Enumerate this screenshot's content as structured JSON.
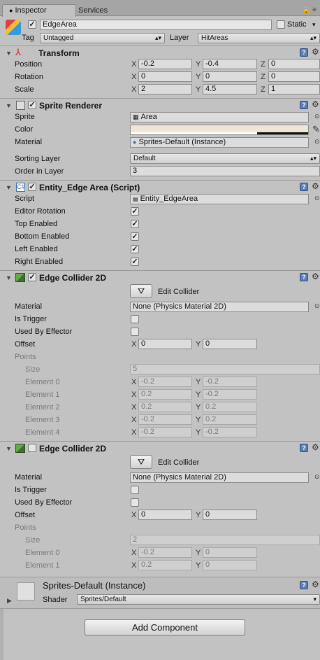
{
  "tabs": {
    "inspector": "Inspector",
    "services": "Services"
  },
  "object": {
    "name": "EdgeArea",
    "static_label": "Static",
    "tag_label": "Tag",
    "tag_value": "Untagged",
    "layer_label": "Layer",
    "layer_value": "HitAreas"
  },
  "transform": {
    "title": "Transform",
    "position_label": "Position",
    "rotation_label": "Rotation",
    "scale_label": "Scale",
    "axis_x": "X",
    "axis_y": "Y",
    "axis_z": "Z",
    "position": {
      "x": "-0.2",
      "y": "-0.4",
      "z": "0"
    },
    "rotation": {
      "x": "0",
      "y": "0",
      "z": "0"
    },
    "scale": {
      "x": "2",
      "y": "4.5",
      "z": "1"
    }
  },
  "sprite_renderer": {
    "title": "Sprite Renderer",
    "sprite_label": "Sprite",
    "sprite_value": "Area",
    "color_label": "Color",
    "color_value": "#f0e6d8",
    "material_label": "Material",
    "material_value": "Sprites-Default (Instance)",
    "sorting_layer_label": "Sorting Layer",
    "sorting_layer_value": "Default",
    "order_label": "Order in Layer",
    "order_value": "3"
  },
  "script_component": {
    "title": "Entity_Edge Area (Script)",
    "script_label": "Script",
    "script_value": "Entity_EdgeArea",
    "fields": [
      {
        "label": "Editor Rotation",
        "checked": true
      },
      {
        "label": "Top Enabled",
        "checked": true
      },
      {
        "label": "Bottom Enabled",
        "checked": true
      },
      {
        "label": "Left Enabled",
        "checked": true
      },
      {
        "label": "Right Enabled",
        "checked": true
      }
    ]
  },
  "edge_collider_1": {
    "title": "Edge Collider 2D",
    "edit_label": "Edit Collider",
    "material_label": "Material",
    "material_value": "None (Physics Material 2D)",
    "trigger_label": "Is Trigger",
    "effector_label": "Used By Effector",
    "offset_label": "Offset",
    "offset_x": "0",
    "offset_y": "0",
    "points_label": "Points",
    "size_label": "Size",
    "size_value": "5",
    "elements": [
      {
        "label": "Element 0",
        "x": "-0.2",
        "y": "-0.2"
      },
      {
        "label": "Element 1",
        "x": "0.2",
        "y": "-0.2"
      },
      {
        "label": "Element 2",
        "x": "0.2",
        "y": "0.2"
      },
      {
        "label": "Element 3",
        "x": "-0.2",
        "y": "0.2"
      },
      {
        "label": "Element 4",
        "x": "-0.2",
        "y": "-0.2"
      }
    ]
  },
  "edge_collider_2": {
    "title": "Edge Collider 2D",
    "edit_label": "Edit Collider",
    "material_label": "Material",
    "material_value": "None (Physics Material 2D)",
    "trigger_label": "Is Trigger",
    "effector_label": "Used By Effector",
    "offset_label": "Offset",
    "offset_x": "0",
    "offset_y": "0",
    "points_label": "Points",
    "size_label": "Size",
    "size_value": "2",
    "elements": [
      {
        "label": "Element 0",
        "x": "-0.2",
        "y": "0"
      },
      {
        "label": "Element 1",
        "x": "0.2",
        "y": "0"
      }
    ]
  },
  "material_preview": {
    "title": "Sprites-Default (Instance)",
    "shader_label": "Shader",
    "shader_value": "Sprites/Default"
  },
  "add_component_label": "Add Component"
}
